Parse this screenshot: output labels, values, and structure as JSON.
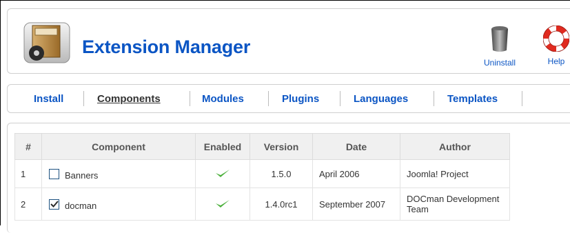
{
  "header": {
    "title": "Extension Manager",
    "icon": "extension-manager-icon",
    "toolbar": [
      {
        "label": "Uninstall",
        "icon": "trash-can-icon"
      },
      {
        "label": "Help",
        "icon": "lifebuoy-icon"
      }
    ]
  },
  "tabs": [
    {
      "label": "Install",
      "active": false
    },
    {
      "label": "Components",
      "active": true
    },
    {
      "label": "Modules",
      "active": false
    },
    {
      "label": "Plugins",
      "active": false
    },
    {
      "label": "Languages",
      "active": false
    },
    {
      "label": "Templates",
      "active": false
    }
  ],
  "table": {
    "columns": [
      "#",
      "Component",
      "Enabled",
      "Version",
      "Date",
      "Author"
    ],
    "rows": [
      {
        "num": "1",
        "component": "Banners",
        "checked": false,
        "enabled": true,
        "version": "1.5.0",
        "date": "April 2006",
        "author": "Joomla! Project"
      },
      {
        "num": "2",
        "component": "docman",
        "checked": true,
        "enabled": true,
        "version": "1.4.0rc1",
        "date": "September 2007",
        "author": "DOCman Development Team"
      }
    ]
  },
  "colors": {
    "link": "#0b55c4",
    "check_green": "#4bb03b"
  }
}
